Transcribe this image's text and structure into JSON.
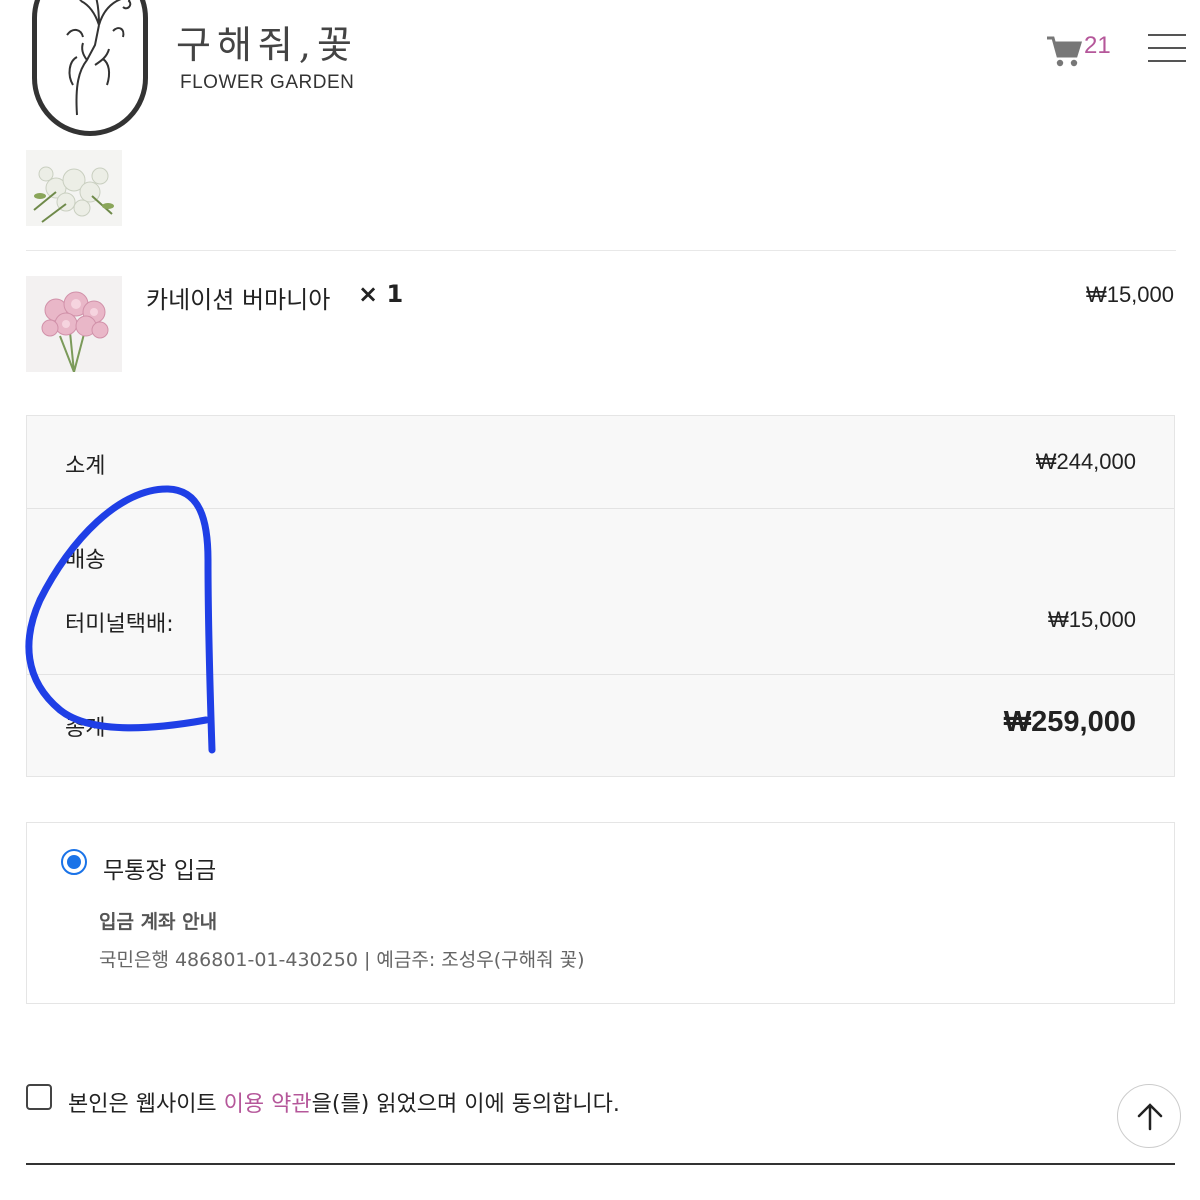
{
  "header": {
    "logo_title": "구해줘,꽃",
    "logo_subtitle": "FLOWER GARDEN",
    "cart_count": "21"
  },
  "order_items": [
    {
      "name": "카네이션 버마니아",
      "qty": "× 1",
      "price": "₩15,000"
    }
  ],
  "totals": {
    "subtotal_label": "소계",
    "subtotal_value": "₩244,000",
    "shipping_label": "배송",
    "shipping_method": "터미널택배:",
    "shipping_value": "₩15,000",
    "total_label": "총계",
    "total_value": "₩259,000"
  },
  "payment": {
    "method_label": "무통장 입금",
    "selected": true,
    "info_title": "입금 계좌 안내",
    "info_text": "국민은행 486801-01-430250 | 예금주: 조성우(구해줘 꽃)"
  },
  "agreement": {
    "prefix": "본인은 웹사이트 ",
    "link_text": "이용 약관",
    "suffix": "을(를) 읽었으며 이에 동의합니다.",
    "checked": false
  },
  "colors": {
    "accent": "#b5579a",
    "radio": "#1a73e8",
    "annotation": "#1f3fe6"
  },
  "icons": [
    "cart-icon",
    "hamburger-menu-icon",
    "arrow-up-icon"
  ]
}
